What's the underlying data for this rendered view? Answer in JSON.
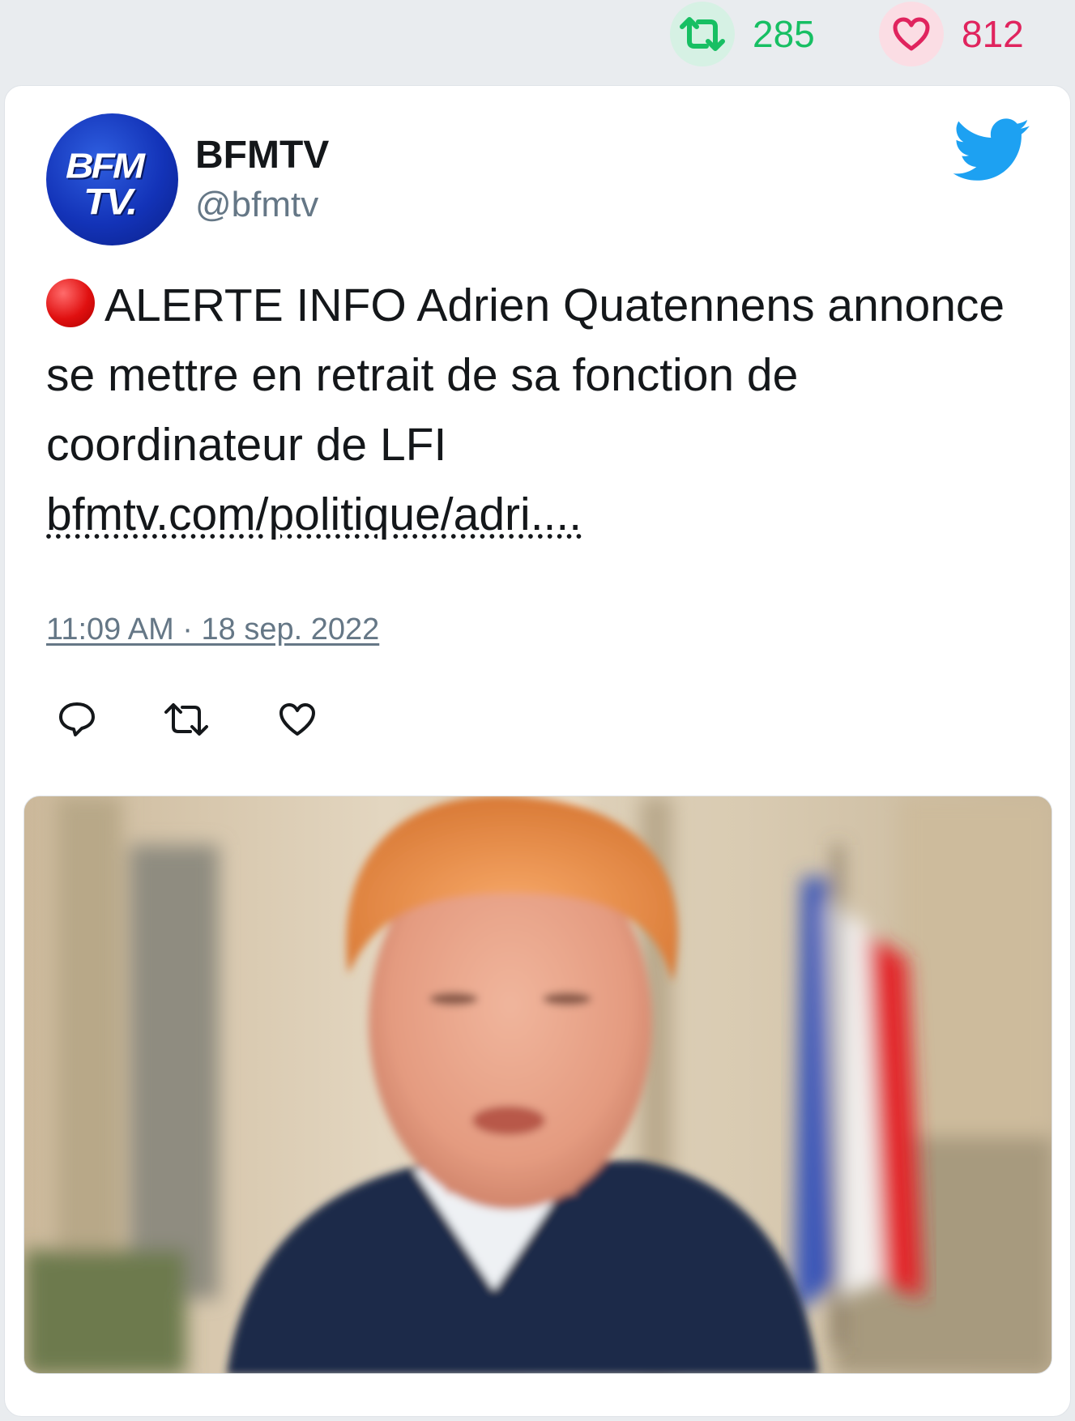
{
  "stats": {
    "retweet_count": "285",
    "like_count": "812"
  },
  "tweet": {
    "author_name": "BFMTV",
    "author_handle": "@bfmtv",
    "avatar_line1": "BFM",
    "avatar_line2": "TV.",
    "text": "ALERTE INFO Adrien Quatennens annonce se mettre en retrait de sa fonction de coordinateur de LFI",
    "link": "bfmtv.com/politique/adri....",
    "timestamp": "11:09 AM · 18 sep. 2022"
  },
  "colors": {
    "retweet_green": "#17bf63",
    "like_red": "#e0245e",
    "twitter_blue": "#1da1f2",
    "muted": "#657786"
  },
  "icons": [
    "retweet-icon",
    "heart-icon",
    "twitter-bird-icon",
    "red-circle-emoji",
    "reply-icon"
  ]
}
